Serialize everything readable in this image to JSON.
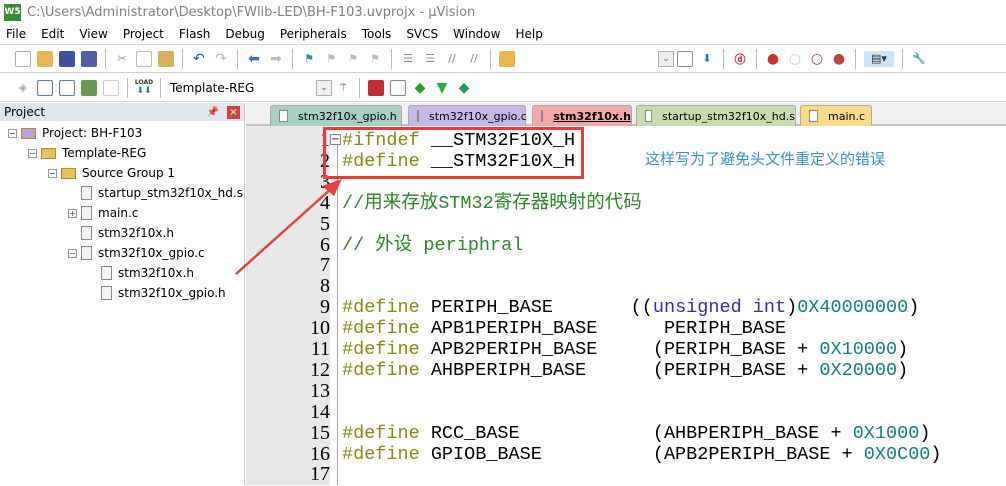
{
  "window": {
    "title": "C:\\Users\\Administrator\\Desktop\\FWlib-LED\\BH-F103.uvprojx - µVision",
    "logo": "W5"
  },
  "menu": [
    "File",
    "Edit",
    "View",
    "Project",
    "Flash",
    "Debug",
    "Peripherals",
    "Tools",
    "SVCS",
    "Window",
    "Help"
  ],
  "toolbar": {
    "target": "Template-REG",
    "load_label": "LOAD"
  },
  "project": {
    "title": "Project",
    "tree": [
      {
        "label": "Project: BH-F103",
        "level": 0,
        "exp": "-",
        "kind": "project"
      },
      {
        "label": "Template-REG",
        "level": 1,
        "exp": "-",
        "kind": "folder"
      },
      {
        "label": "Source Group 1",
        "level": 2,
        "exp": "-",
        "kind": "folder"
      },
      {
        "label": "startup_stm32f10x_hd.s",
        "level": 3,
        "exp": "",
        "kind": "file"
      },
      {
        "label": "main.c",
        "level": 3,
        "exp": "+",
        "kind": "file"
      },
      {
        "label": "stm32f10x.h",
        "level": 3,
        "exp": "",
        "kind": "file"
      },
      {
        "label": "stm32f10x_gpio.c",
        "level": 3,
        "exp": "-",
        "kind": "file"
      },
      {
        "label": "stm32f10x.h",
        "level": 4,
        "exp": "",
        "kind": "file"
      },
      {
        "label": "stm32f10x_gpio.h",
        "level": 4,
        "exp": "",
        "kind": "file"
      }
    ]
  },
  "tabs": [
    {
      "label": "stm32f10x_gpio.h",
      "color": "#a8cfc4",
      "active": false
    },
    {
      "label": "stm32f10x_gpio.c",
      "color": "#c8b8e8",
      "active": false
    },
    {
      "label": "stm32f10x.h",
      "color": "#f0a8a8",
      "active": true
    },
    {
      "label": "startup_stm32f10x_hd.s",
      "color": "#c8dcb0",
      "active": false
    },
    {
      "label": "main.c",
      "color": "#f8dc88",
      "active": false
    }
  ],
  "code": [
    [
      [
        "pp",
        "#ifndef"
      ],
      [
        "tx",
        " __STM32F10X_H"
      ]
    ],
    [
      [
        "pp",
        "#define"
      ],
      [
        "tx",
        " __STM32F10X_H"
      ]
    ],
    [],
    [
      [
        "cm",
        "//用来存放STM32寄存器映射的代码"
      ]
    ],
    [],
    [
      [
        "cm",
        "// 外设 periphral"
      ]
    ],
    [],
    [],
    [
      [
        "pp",
        "#define"
      ],
      [
        "tx",
        " PERIPH_BASE       (("
      ],
      [
        "kw",
        "unsigned int"
      ],
      [
        "tx",
        ")"
      ],
      [
        "num",
        "0X40000000"
      ],
      [
        "tx",
        ")"
      ]
    ],
    [
      [
        "pp",
        "#define"
      ],
      [
        "tx",
        " APB1PERIPH_BASE      PERIPH_BASE"
      ]
    ],
    [
      [
        "pp",
        "#define"
      ],
      [
        "tx",
        " APB2PERIPH_BASE     (PERIPH_BASE + "
      ],
      [
        "num",
        "0X10000"
      ],
      [
        "tx",
        ")"
      ]
    ],
    [
      [
        "pp",
        "#define"
      ],
      [
        "tx",
        " AHBPERIPH_BASE      (PERIPH_BASE + "
      ],
      [
        "num",
        "0X20000"
      ],
      [
        "tx",
        ")"
      ]
    ],
    [],
    [],
    [
      [
        "pp",
        "#define"
      ],
      [
        "tx",
        " RCC_BASE            (AHBPERIPH_BASE + "
      ],
      [
        "num",
        "0X1000"
      ],
      [
        "tx",
        ")"
      ]
    ],
    [
      [
        "pp",
        "#define"
      ],
      [
        "tx",
        " GPIOB_BASE          (APB2PERIPH_BASE + "
      ],
      [
        "num",
        "0X0C00"
      ],
      [
        "tx",
        ")"
      ]
    ],
    []
  ],
  "annotation": {
    "text": "这样写为了避免头文件重定义的错误",
    "color": "#3a8fd8",
    "highlight_color": "#e04040"
  }
}
